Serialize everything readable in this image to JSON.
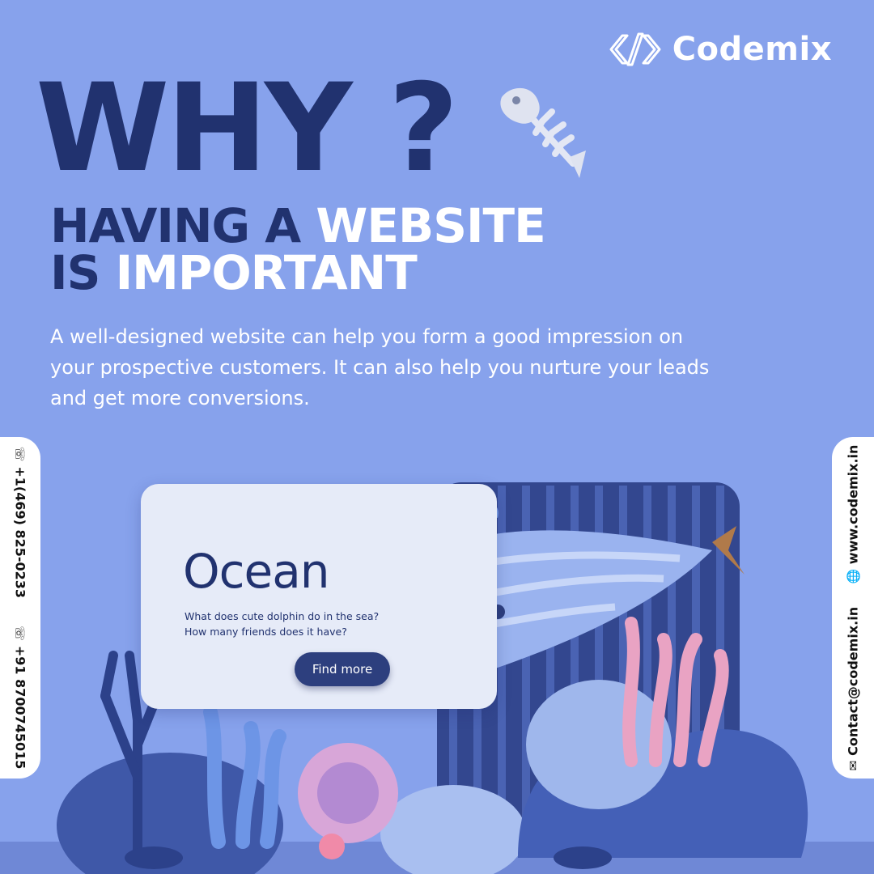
{
  "brand": {
    "name": "Codemix",
    "icon": "code-brackets-icon"
  },
  "hero": {
    "why": "WHY ?",
    "line1_dark": "HAVING A",
    "line1_light": "WEBSITE",
    "line2_dark": "IS",
    "line2_light": "IMPORTANT"
  },
  "description": "A well-designed website can help you form a good impression on your prospective customers. It can also help you nurture your leads and get more conversions.",
  "contact_left": {
    "phone1": "+1(469) 825-0233",
    "phone2": "+91 8700745015",
    "icon": "phone-icon"
  },
  "contact_right": {
    "website": "www.codemix.in",
    "email": "Contact@codemix.in",
    "website_icon": "globe-icon",
    "email_icon": "mail-icon"
  },
  "card": {
    "title": "Ocean",
    "description": "What does cute dolphin do in the sea? How many friends does it have?",
    "button": "Find more"
  },
  "colors": {
    "background": "#87a2ec",
    "dark_text": "#21326f",
    "light_text": "#ffffff",
    "card_bg": "#e6ebf8",
    "button_bg": "#2d3f7e"
  }
}
